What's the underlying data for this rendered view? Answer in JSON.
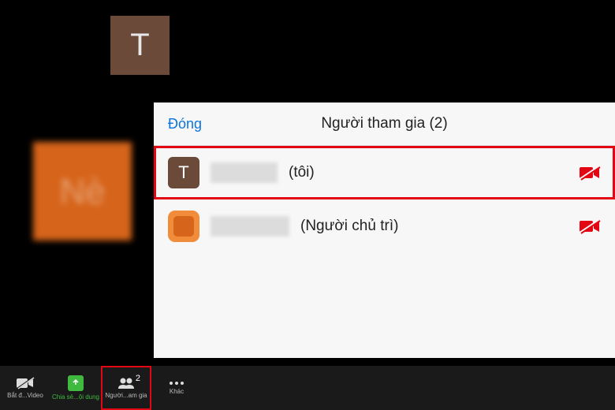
{
  "video_tiles": {
    "top": {
      "initial": "T"
    },
    "side": {
      "initial": "Nè"
    }
  },
  "panel": {
    "close_label": "Đóng",
    "title": "Người tham gia (2)"
  },
  "participants": [
    {
      "initial": "T",
      "suffix": "(tôi)",
      "camera_off": true,
      "highlighted": true
    },
    {
      "initial": "",
      "suffix": "(Người chủ trì)",
      "camera_off": true,
      "highlighted": false
    }
  ],
  "toolbar": {
    "video": {
      "label": "Bắt đ...Video"
    },
    "share": {
      "label": "Chia sẻ...ội dung"
    },
    "participants": {
      "label": "Người...am gia",
      "count": "2"
    },
    "more": {
      "label": "Khác"
    }
  }
}
